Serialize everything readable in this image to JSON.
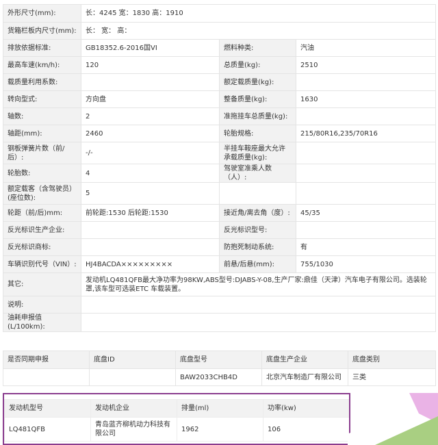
{
  "spec_rows": [
    {
      "l1": "外形尺寸(mm):",
      "v1": "长：4245 宽：1830 高：1910"
    },
    {
      "l1": "货箱栏板内尺寸(mm):",
      "v1": "长：  宽：  高："
    },
    {
      "l1": "排放依据标准:",
      "v1": "GB18352.6-2016国VI",
      "l2": "燃料种类:",
      "v2": "汽油"
    },
    {
      "l1": "最高车速(km/h):",
      "v1": "120",
      "l2": "总质量(kg):",
      "v2": "2510"
    },
    {
      "l1": "载质量利用系数:",
      "v1": "",
      "l2": "额定载质量(kg):",
      "v2": ""
    },
    {
      "l1": "转向型式:",
      "v1": "方向盘",
      "l2": "整备质量(kg):",
      "v2": "1630"
    },
    {
      "l1": "轴数:",
      "v1": "2",
      "l2": "准拖挂车总质量(kg):",
      "v2": ""
    },
    {
      "l1": "轴距(mm):",
      "v1": "2460",
      "l2": "轮胎规格:",
      "v2": "215/80R16,235/70R16"
    },
    {
      "l1": "钢板弹簧片数（前/后）:",
      "v1": "-/-",
      "l2": "半挂车鞍座最大允许承载质量(kg):",
      "v2": ""
    },
    {
      "l1": "轮胎数:",
      "v1": "4",
      "l2": "驾驶室准乘人数（人）:",
      "v2": ""
    },
    {
      "l1": "额定载客（含驾驶员）(座位数):",
      "v1": "5",
      "l2": "",
      "v2": ""
    },
    {
      "l1": "轮距（前/后)mm:",
      "v1": "前轮距:1530 后轮距:1530",
      "l2": "接近角/离去角（度）:",
      "v2": "45/35"
    },
    {
      "l1": "反光标识生产企业:",
      "v1": "",
      "l2": "反光标识型号:",
      "v2": ""
    },
    {
      "l1": "反光标识商标:",
      "v1": "",
      "l2": "防抱死制动系统:",
      "v2": "有"
    },
    {
      "l1": "车辆识别代号（VIN）:",
      "v1": "HJ4BACDA×××××××××",
      "l2": "前悬/后悬(mm):",
      "v2": "755/1030"
    },
    {
      "l1": "其它:",
      "v1": "发动机LQ481QFB最大净功率为98KW,ABS型号:DJABS-Y-08,生产厂家:鼎佳（天津）汽车电子有限公司。选装轮罩,该车型可选装ETC 车载装置。"
    },
    {
      "l1": "说明:",
      "v1": ""
    },
    {
      "l1": "油耗申报值(L/100km):",
      "v1": ""
    }
  ],
  "chassis": {
    "headers": [
      "是否同期申报",
      "底盘ID",
      "底盘型号",
      "底盘生产企业",
      "底盘类别"
    ],
    "row": [
      "",
      "",
      "BAW2033CHB4D",
      "北京汽车制造厂有限公司",
      "三类"
    ]
  },
  "engine": {
    "headers": [
      "发动机型号",
      "发动机企业",
      "排量(ml)",
      "功率(kw)"
    ],
    "row": [
      "LQ481QFB",
      "青岛蓝齐柳机动力科技有限公司",
      "1962",
      "106"
    ]
  },
  "colors": {
    "label_bg": "#f2f2f2",
    "border": "#e4e4e4",
    "highlight_frame": "#8a3c8e",
    "watermark_pink": "#e6a6e2",
    "watermark_green": "#a9cf82"
  }
}
